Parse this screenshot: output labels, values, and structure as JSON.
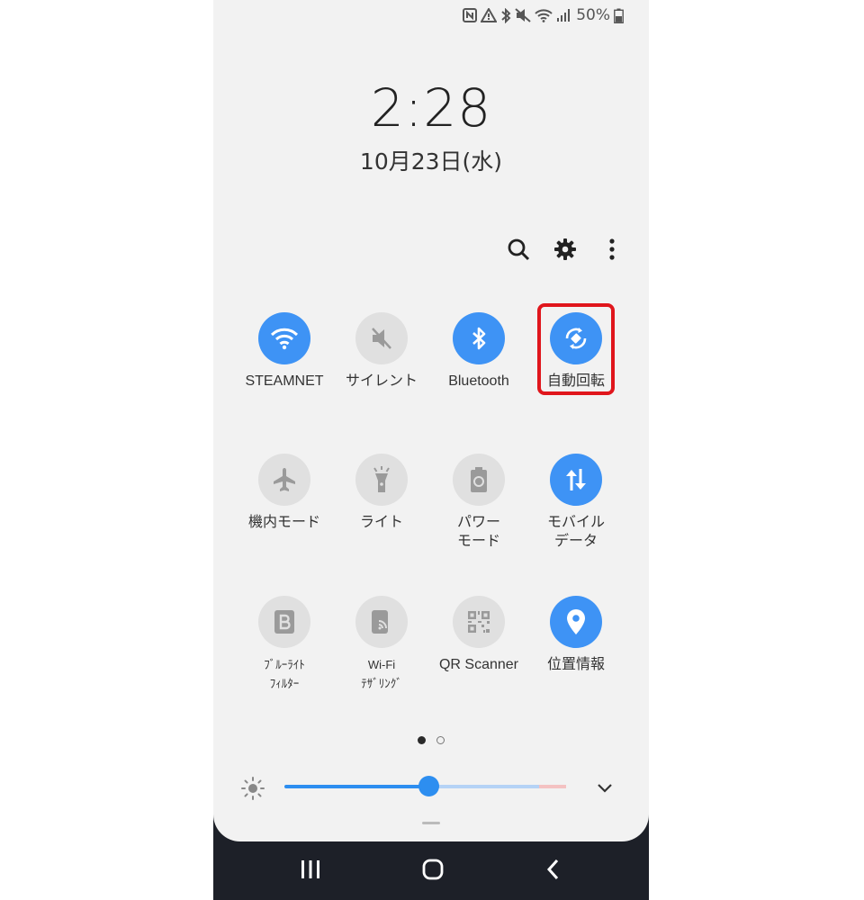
{
  "status_bar": {
    "battery": "50%"
  },
  "lock": {
    "time": "2:28",
    "date": "10月23日(水)"
  },
  "toolbar": {
    "search_icon": "search-icon",
    "settings_icon": "gear-icon",
    "more_icon": "more-vert-icon"
  },
  "tiles": [
    {
      "label": "STEAMNET",
      "icon": "wifi-icon",
      "on": true
    },
    {
      "label": "サイレント",
      "icon": "mute-icon",
      "on": false
    },
    {
      "label": "Bluetooth",
      "icon": "bluetooth-icon",
      "on": true
    },
    {
      "label": "自動回転",
      "icon": "auto-rotate-icon",
      "on": true
    },
    {
      "label": "機内モード",
      "icon": "airplane-icon",
      "on": false
    },
    {
      "label": "ライト",
      "icon": "flashlight-icon",
      "on": false
    },
    {
      "label": "パワー\nモード",
      "icon": "power-mode-icon",
      "on": false
    },
    {
      "label": "モバイル\nデータ",
      "icon": "mobile-data-icon",
      "on": true
    },
    {
      "label": "ﾌﾞﾙｰﾗｲﾄ\nﾌｨﾙﾀｰ",
      "icon": "blue-light-filter-icon",
      "on": false
    },
    {
      "label": "Wi-Fi\nﾃｻﾞﾘﾝｸﾞ",
      "icon": "hotspot-icon",
      "on": false
    },
    {
      "label": "QR Scanner",
      "icon": "qr-icon",
      "on": false
    },
    {
      "label": "位置情報",
      "icon": "location-icon",
      "on": true
    }
  ],
  "brightness": {
    "level": 0.51
  },
  "colors": {
    "accent": "#3e93f5",
    "highlight": "#e0161c",
    "panel": "#f2f2f2",
    "navbar": "#1d2028"
  }
}
